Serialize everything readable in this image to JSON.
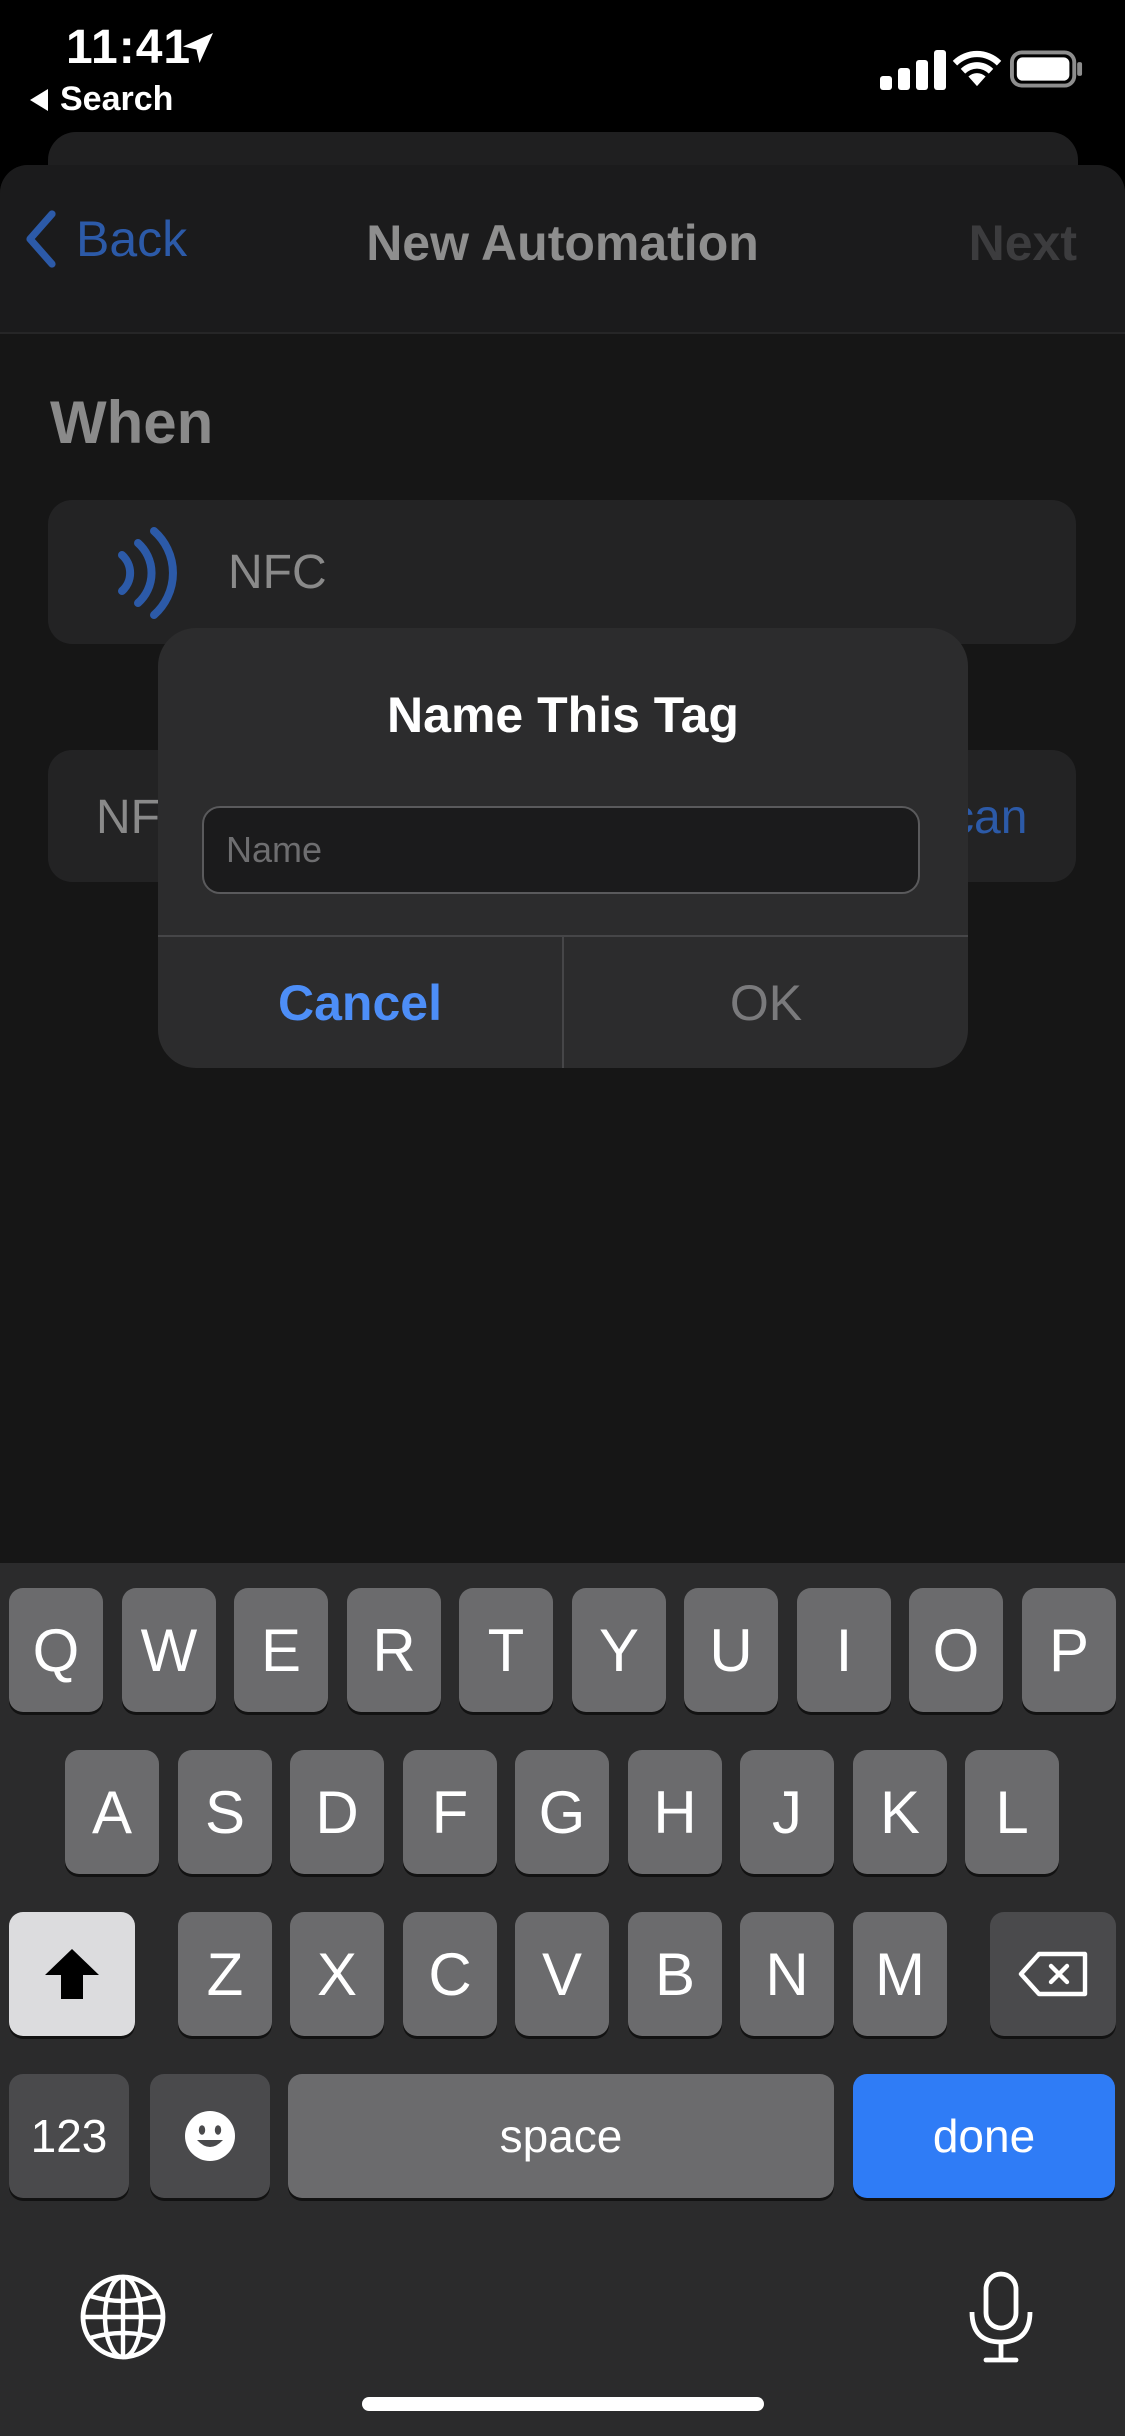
{
  "status_bar": {
    "time": "11:41",
    "back_app": "Search"
  },
  "nav": {
    "back_label": "Back",
    "title": "New Automation",
    "next_label": "Next"
  },
  "content": {
    "section_header": "When",
    "trigger_label": "NFC",
    "tag_row_left": "NF",
    "tag_row_right": "can"
  },
  "dialog": {
    "title": "Name This Tag",
    "input_placeholder": "Name",
    "input_value": "",
    "cancel_label": "Cancel",
    "ok_label": "OK"
  },
  "keyboard": {
    "row1": [
      "Q",
      "W",
      "E",
      "R",
      "T",
      "Y",
      "U",
      "I",
      "O",
      "P"
    ],
    "row2": [
      "A",
      "S",
      "D",
      "F",
      "G",
      "H",
      "J",
      "K",
      "L"
    ],
    "row3": [
      "Z",
      "X",
      "C",
      "V",
      "B",
      "N",
      "M"
    ],
    "numbers_label": "123",
    "space_label": "space",
    "done_label": "done"
  },
  "colors": {
    "accent": "#2f7cf6",
    "link": "#4d8ef7"
  },
  "icons": [
    "location-arrow-icon",
    "signal-icon",
    "wifi-icon",
    "battery-icon",
    "chevron-left-icon",
    "nfc-icon",
    "shift-icon",
    "delete-icon",
    "emoji-icon",
    "globe-icon",
    "mic-icon"
  ]
}
